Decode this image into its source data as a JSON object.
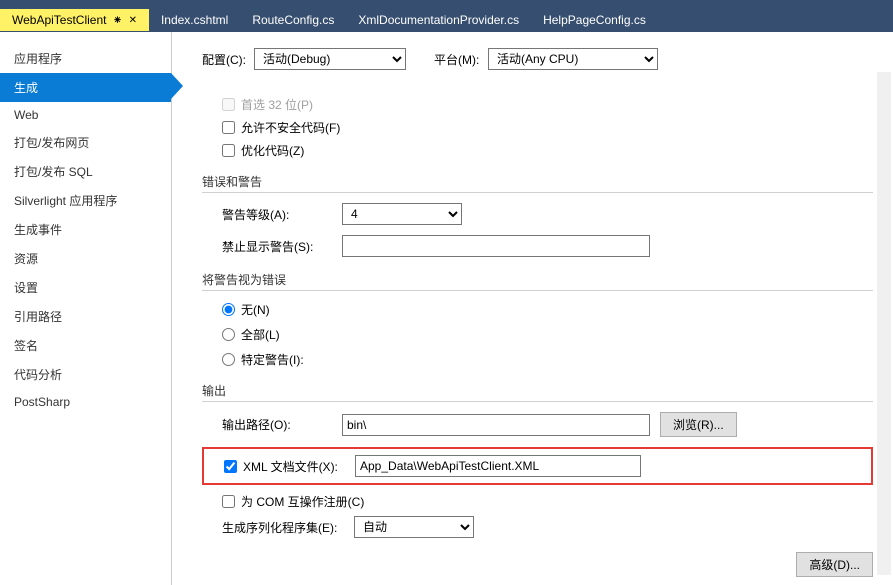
{
  "tabs": [
    {
      "label": "WebApiTestClient",
      "active": true
    },
    {
      "label": "Index.cshtml"
    },
    {
      "label": "RouteConfig.cs"
    },
    {
      "label": "XmlDocumentationProvider.cs"
    },
    {
      "label": "HelpPageConfig.cs"
    }
  ],
  "sidebar": {
    "items": [
      {
        "label": "应用程序"
      },
      {
        "label": "生成",
        "selected": true
      },
      {
        "label": "Web"
      },
      {
        "label": "打包/发布网页"
      },
      {
        "label": "打包/发布 SQL"
      },
      {
        "label": "Silverlight 应用程序"
      },
      {
        "label": "生成事件"
      },
      {
        "label": "资源"
      },
      {
        "label": "设置"
      },
      {
        "label": "引用路径"
      },
      {
        "label": "签名"
      },
      {
        "label": "代码分析"
      },
      {
        "label": "PostSharp"
      }
    ]
  },
  "topRow": {
    "configLabel": "配置(C):",
    "configValue": "活动(Debug)",
    "platformLabel": "平台(M):",
    "platformValue": "活动(Any CPU)"
  },
  "general": {
    "prefer32": "首选 32 位(P)",
    "allowUnsafe": "允许不安全代码(F)",
    "optimize": "优化代码(Z)"
  },
  "errorsSection": {
    "title": "错误和警告",
    "warnLevelLabel": "警告等级(A):",
    "warnLevelValue": "4",
    "suppressLabel": "禁止显示警告(S):",
    "suppressValue": ""
  },
  "treatSection": {
    "title": "将警告视为错误",
    "none": "无(N)",
    "all": "全部(L)",
    "specific": "特定警告(I):"
  },
  "outputSection": {
    "title": "输出",
    "pathLabel": "输出路径(O):",
    "pathValue": "bin\\",
    "browseLabel": "浏览(R)...",
    "xmlDocLabel": "XML 文档文件(X):",
    "xmlDocValue": "App_Data\\WebApiTestClient.XML",
    "comLabel": "为 COM 互操作注册(C)",
    "serialLabel": "生成序列化程序集(E):",
    "serialValue": "自动"
  },
  "advancedLabel": "高级(D)..."
}
